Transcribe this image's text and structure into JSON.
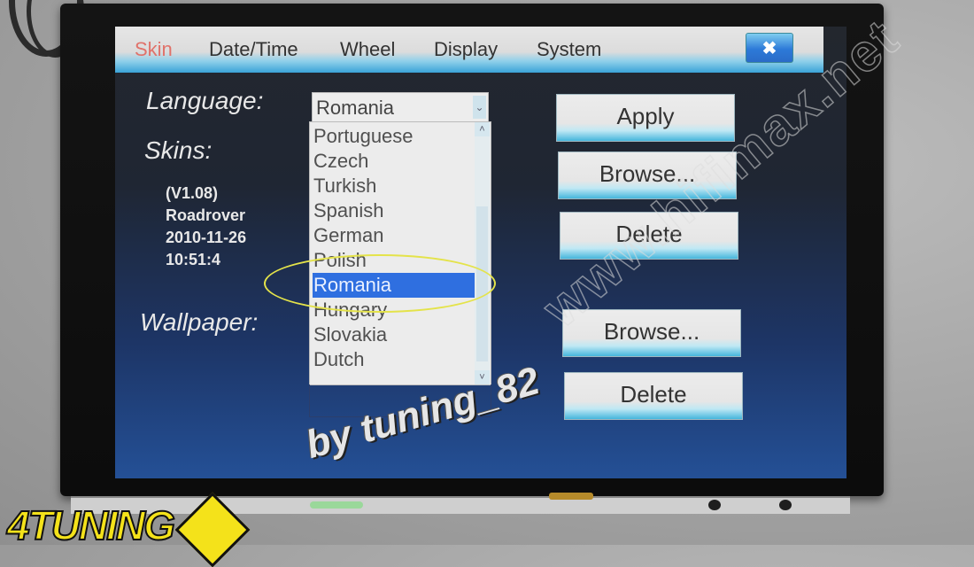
{
  "tabs": [
    {
      "label": "Skin",
      "active": true
    },
    {
      "label": "Date/Time",
      "active": false
    },
    {
      "label": "Wheel",
      "active": false
    },
    {
      "label": "Display",
      "active": false
    },
    {
      "label": "System",
      "active": false
    }
  ],
  "close_button": {
    "icon": "close-icon",
    "glyph": "✖"
  },
  "language": {
    "label": "Language:",
    "selected": "Romania",
    "dropdown_arrow": "⌄",
    "options": [
      "Portuguese",
      "Czech",
      "Turkish",
      "Spanish",
      "German",
      "Polish",
      "Romania",
      "Hungary",
      "Slovakia",
      "Dutch"
    ],
    "highlighted_index": 6,
    "scroll_up": "˄",
    "scroll_down": "˅"
  },
  "skins": {
    "label": "Skins:",
    "info": [
      "(V1.08)",
      "Roadrover",
      "2010-11-26",
      "10:51:4"
    ]
  },
  "wallpaper": {
    "label": "Wallpaper:"
  },
  "buttons": {
    "apply": "Apply",
    "skin_browse": "Browse...",
    "skin_delete": "Delete",
    "wallpaper_browse": "Browse...",
    "wallpaper_delete": "Delete"
  },
  "watermarks": {
    "site": "www.hifimax.net",
    "author": "by tuning_82",
    "logo": "4TUNING"
  },
  "colors": {
    "active_tab": "#e0726a",
    "selection": "#2f6fe0",
    "annotation_ellipse": "#e4e34a",
    "logo_yellow": "#f4e21a"
  }
}
